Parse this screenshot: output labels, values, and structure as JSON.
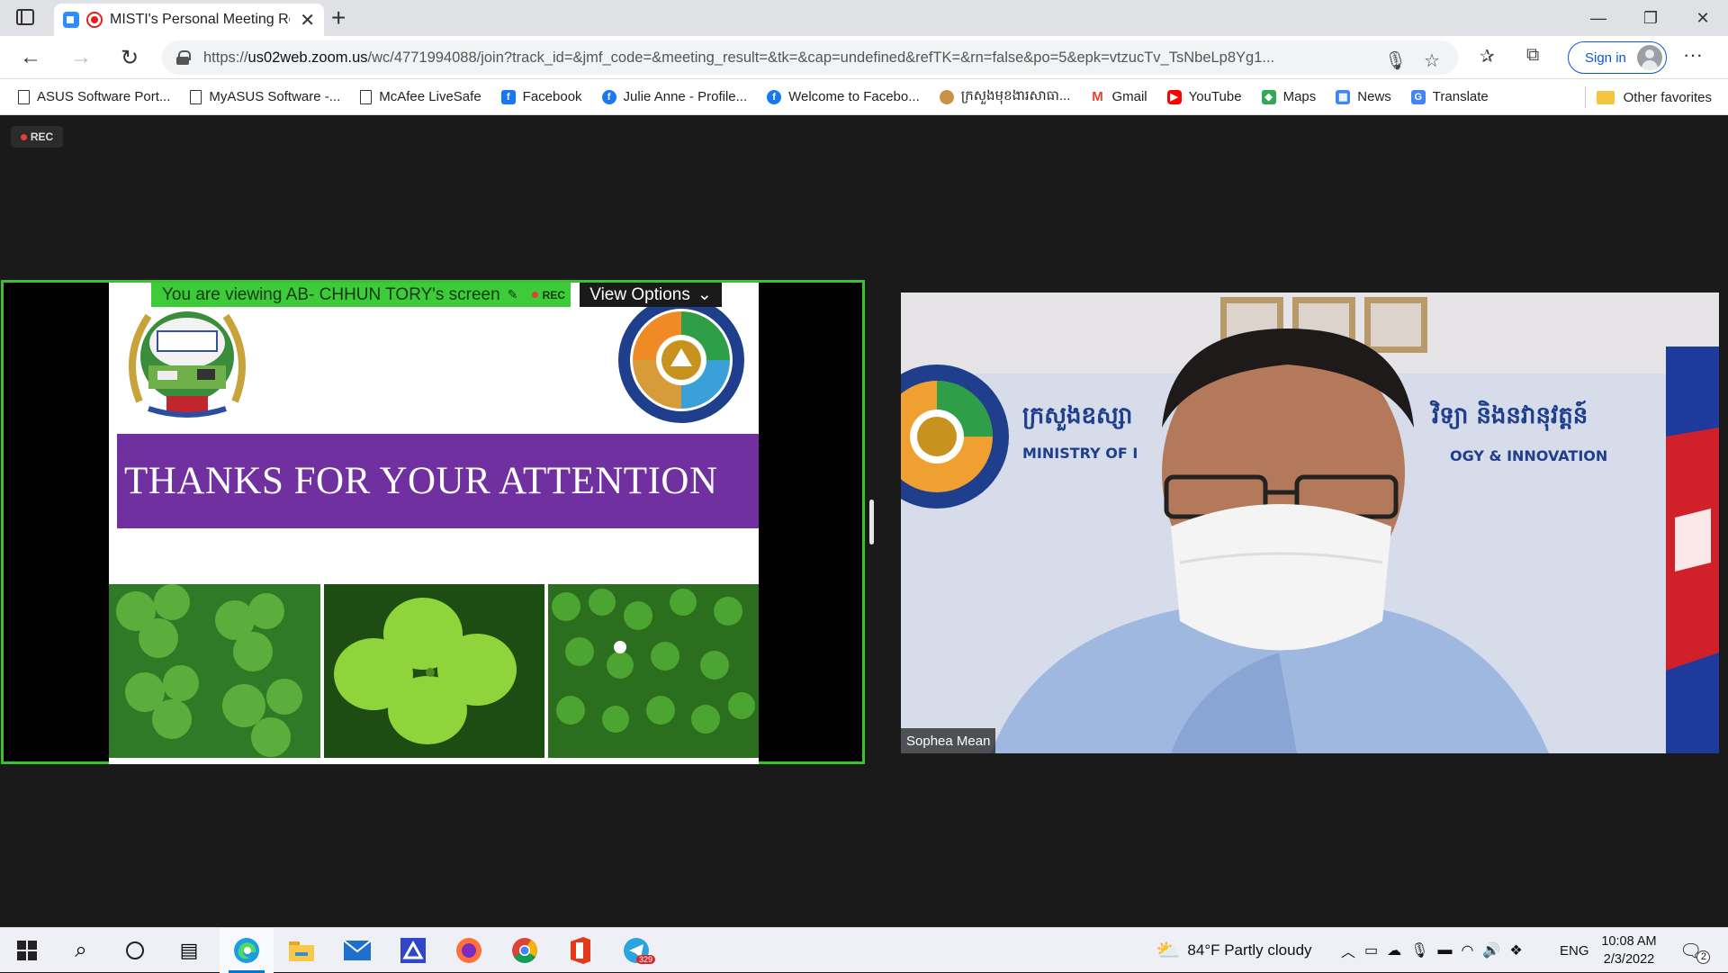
{
  "browser": {
    "tab_title": "MISTI's Personal Meeting Room",
    "url_prefix": "https://",
    "url_host": "us02web.zoom.us",
    "url_path": "/wc/4771994088/join?track_id=&jmf_code=&meeting_result=&tk=&cap=undefined&refTK=&rn=false&po=5&epk=vtzucTv_TsNbeLp8Yg1...",
    "signin_label": "Sign in",
    "bookmarks": [
      {
        "label": "ASUS Software Port...",
        "icon": "document-icon"
      },
      {
        "label": "MyASUS Software -...",
        "icon": "document-icon"
      },
      {
        "label": "McAfee LiveSafe",
        "icon": "document-icon"
      },
      {
        "label": "Facebook",
        "icon": "facebook-icon"
      },
      {
        "label": "Julie Anne - Profile...",
        "icon": "facebook-icon"
      },
      {
        "label": "Welcome to Facebo...",
        "icon": "facebook-icon"
      },
      {
        "label": "ក្រសួងមុខងារសាធា...",
        "icon": "khmer-emblem-icon"
      },
      {
        "label": "Gmail",
        "icon": "gmail-icon"
      },
      {
        "label": "YouTube",
        "icon": "youtube-icon"
      },
      {
        "label": "Maps",
        "icon": "maps-icon"
      },
      {
        "label": "News",
        "icon": "news-icon"
      },
      {
        "label": "Translate",
        "icon": "translate-icon"
      }
    ],
    "other_favorites": "Other favorites"
  },
  "meeting": {
    "rec_label": "REC",
    "share_banner": "You are viewing AB- CHHUN TORY's screen",
    "banner_rec": "REC",
    "view_options": "View Options",
    "slide_title": "THANKS FOR YOUR ATTENTION",
    "participant_name": "Sophea Mean",
    "video_wall_text_1": "ក្រសួងឧស្សា",
    "video_wall_text_2": "MINISTRY OF I",
    "video_wall_text_3": "វិទ្យា និងនវានុវត្តន៍",
    "video_wall_text_4": "OGY & INNOVATION"
  },
  "taskbar": {
    "weather": "84°F  Partly cloudy",
    "language": "ENG",
    "time": "10:08 AM",
    "date": "2/3/2022",
    "telegram_badge": "329",
    "notification_count": "2"
  },
  "colors": {
    "share_border": "#39c12e",
    "slide_band": "#7030a0",
    "zoom_blue": "#2d8cff"
  }
}
